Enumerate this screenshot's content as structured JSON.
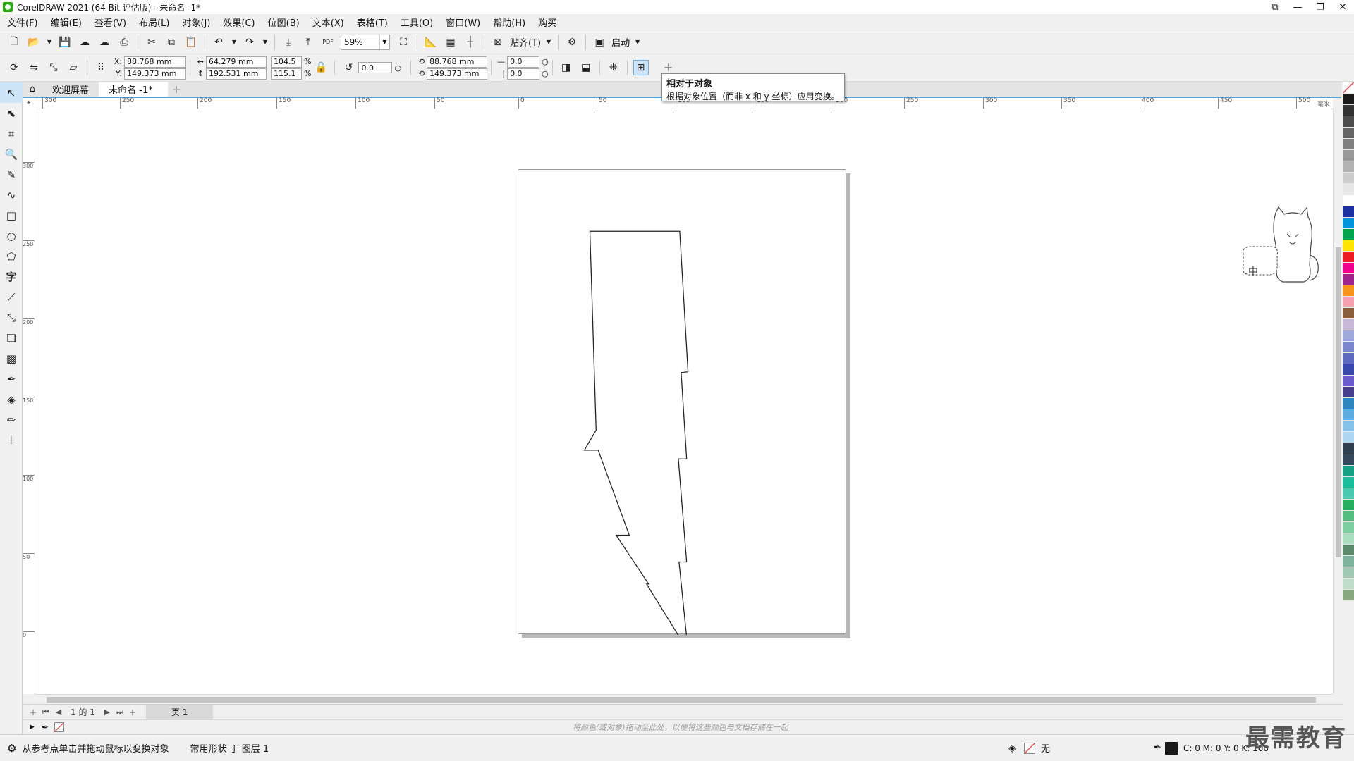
{
  "window": {
    "title": "CorelDRAW 2021 (64-Bit 评估版) - 未命名 -1*"
  },
  "menu": [
    "文件(F)",
    "编辑(E)",
    "查看(V)",
    "布局(L)",
    "对象(J)",
    "效果(C)",
    "位图(B)",
    "文本(X)",
    "表格(T)",
    "工具(O)",
    "窗口(W)",
    "帮助(H)",
    "购买"
  ],
  "toolbar": {
    "zoom": "59%",
    "snap_label": "贴齐(T)",
    "launch_label": "启动",
    "pdf_label": "PDF"
  },
  "props": {
    "x_label": "X:",
    "y_label": "Y:",
    "x": "88.768 mm",
    "y": "149.373 mm",
    "w": "64.279 mm",
    "h": "192.531 mm",
    "sx": "104.5",
    "sy": "115.1",
    "pct": "%",
    "rotation": "0.0",
    "cx": "88.768 mm",
    "cy": "149.373 mm",
    "skew_h": "0.0",
    "skew_v": "0.0"
  },
  "tooltip": {
    "title": "相对于对象",
    "text": "根据对象位置（而非 x 和 y 坐标）应用变换。"
  },
  "tabs": {
    "welcome": "欢迎屏幕",
    "doc": "未命名 -1*"
  },
  "ruler": {
    "h_ticks": [
      "300",
      "250",
      "200",
      "150",
      "100",
      "50",
      "0",
      "50",
      "100",
      "150",
      "200",
      "250",
      "300",
      "350",
      "400",
      "450",
      "500"
    ],
    "v_ticks": [
      "300",
      "250",
      "200",
      "150",
      "100",
      "50",
      "0"
    ],
    "unit": "毫米"
  },
  "pagenav": {
    "page_of": "1 的 1",
    "page_tab": "页 1"
  },
  "docpalette": {
    "hint": "将颜色(或对象)拖动至此处，以便将这些颜色与文档存储在一起"
  },
  "status": {
    "left": "从参考点单击并拖动鼠标以变换对象",
    "object": "常用形状 于 图层 1",
    "fill": "无",
    "cmyk": "C: 0 M: 0 Y: 0 K: 100"
  },
  "mascot": {
    "text": "中"
  },
  "watermark": "最需教育",
  "colors": {
    "accent": "#4aa3e0",
    "palette": [
      "#1a1a1a",
      "#333333",
      "#4d4d4d",
      "#666666",
      "#808080",
      "#999999",
      "#b3b3b3",
      "#cccccc",
      "#e6e6e6",
      "#ffffff",
      "#1c2fa0",
      "#0093dd",
      "#00a550",
      "#ffe600",
      "#ec1c24",
      "#ec008c",
      "#a3238e",
      "#f7941d",
      "#f5a0b0",
      "#8b5e3c",
      "#c8b8d8",
      "#9fa8da",
      "#7986cb",
      "#5c6bc0",
      "#3949ab",
      "#6a5acd",
      "#483d8b",
      "#2e86c1",
      "#5dade2",
      "#85c1e9",
      "#aed6f1",
      "#2c3e50",
      "#34495e",
      "#16a085",
      "#1abc9c",
      "#48c9b0",
      "#27ae60",
      "#52be80",
      "#7dcea0",
      "#a9dfbf",
      "#5d8a6a",
      "#7fb3a0",
      "#a0c8b5",
      "#c0dccb",
      "#88a880"
    ]
  }
}
